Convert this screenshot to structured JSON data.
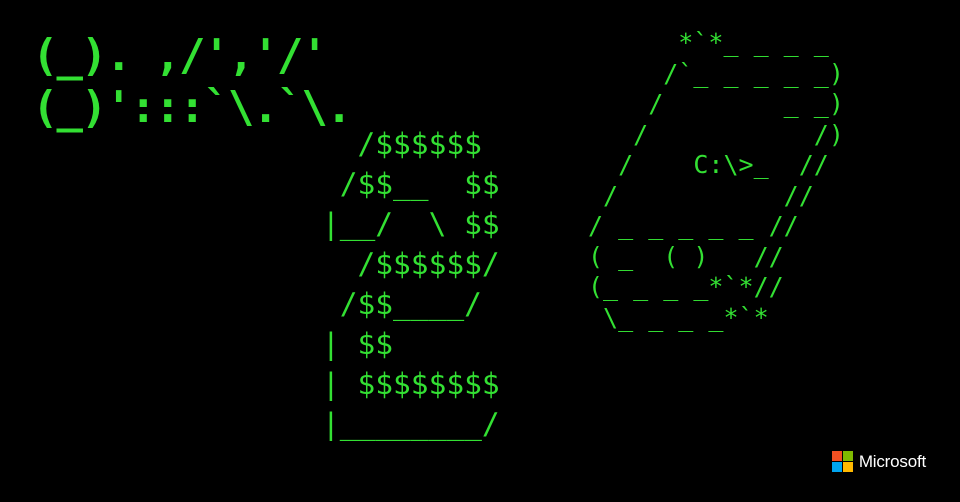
{
  "art": {
    "scissors": "(_). ,/','/'\n(_)':::`\\.`\\.",
    "number2": "  /$$$$$$\n /$$__  $$\n|__/  \\ $$\n  /$$$$$$/\n /$$____/\n| $$\n| $$$$$$$$\n|________/",
    "phone": "      *`*_ _ _ _\n     /`_ _ _ _ _)\n    /        _ _)\n   /           /)\n  /    C:\\>_  //\n /           //\n/ _ _ _ _ _ //\n( _  ( )   //\n(_ _ _ _*`*//\n \\_ _ _ _*`*"
  },
  "brand": {
    "name": "Microsoft",
    "colors": [
      "#f25022",
      "#7fba00",
      "#00a4ef",
      "#ffb900"
    ]
  },
  "colors": {
    "background": "#000000",
    "ascii_green": "#33e033"
  }
}
